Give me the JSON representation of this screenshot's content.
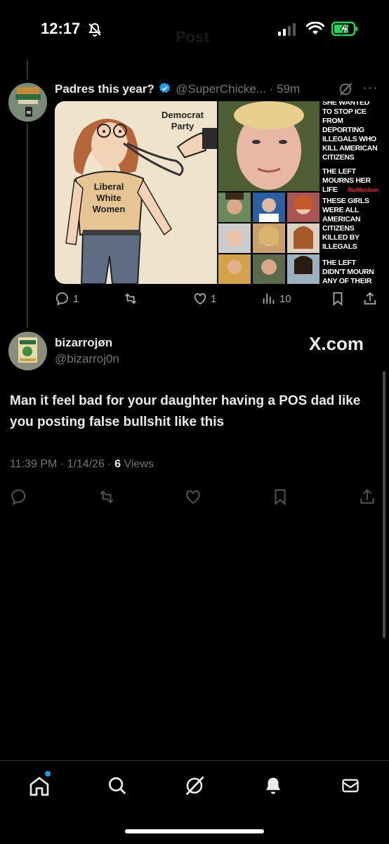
{
  "status_bar": {
    "time": "12:17"
  },
  "header": {
    "title": "Post"
  },
  "quoted_post": {
    "display_name": "Padres this year?",
    "handle": "@SuperChicke...",
    "separator": "·",
    "time_ago": "59m",
    "media_left": {
      "label_party_line1": "Democrat",
      "label_party_line2": "Party",
      "shirt_line1": "Liberal",
      "shirt_line2": "White",
      "shirt_line3": "Women"
    },
    "media_right": {
      "top_text": "SHE WANTED TO STOP ICE FROM DEPORTING ILLEGALS WHO KILL AMERICAN CITIZENS",
      "mourn_text": "THE LEFT MOURNS HER LIFE",
      "signature": "RioMorrison",
      "girls_text": "THESE GIRLS WERE ALL AMERICAN CITIZENS KILLED BY ILLEGALS",
      "didnt_text": "THE LEFT DIDN'T MOURN ANY OF THEIR LIVES"
    },
    "actions": {
      "replies": "1",
      "reposts": "",
      "likes": "1",
      "views": "10"
    }
  },
  "reply_post": {
    "display_name": "bizarrojøn",
    "handle": "@bizarroj0n",
    "watermark": "X.com",
    "text": "Man it feel bad for your daughter having a POS dad like you posting false bullshit like this",
    "time": "11:39 PM",
    "dot": "·",
    "date": "1/14/26",
    "views_count": "6",
    "views_label": "Views"
  },
  "colors": {
    "accent": "#1d9bf0",
    "verified": "#1d9bf0",
    "battery": "#30d158"
  },
  "nav": {
    "items": [
      "home-icon",
      "search-icon",
      "grok-icon",
      "notifications-icon",
      "messages-icon"
    ]
  }
}
